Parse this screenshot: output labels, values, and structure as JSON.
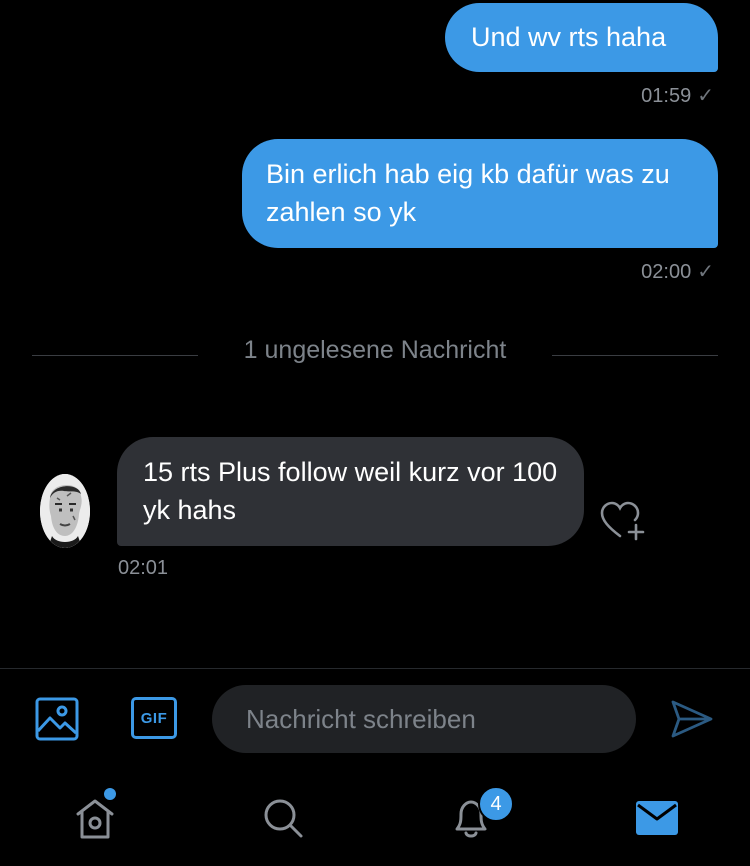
{
  "messages": [
    {
      "text": "Und wv rts haha",
      "time": "01:59"
    },
    {
      "text": "Bin erlich hab eig kb dafür was zu zahlen so yk",
      "time": "02:00"
    },
    {
      "text": "15 rts Plus follow weil kurz vor 100 yk hahs",
      "time": "02:01"
    }
  ],
  "check_glyph": "✓",
  "unread_divider": "1 ungelesene Nachricht",
  "composer": {
    "placeholder": "Nachricht schreiben",
    "gif_label": "GIF"
  },
  "tabbar": {
    "notification_count": "4"
  },
  "colors": {
    "accent": "#3c99e6",
    "incoming_bubble": "#2f3136",
    "background": "#000000"
  },
  "icons": [
    "image-icon",
    "gif-icon",
    "send-icon",
    "home-icon",
    "search-icon",
    "bell-icon",
    "mail-icon",
    "heart-plus-icon"
  ]
}
